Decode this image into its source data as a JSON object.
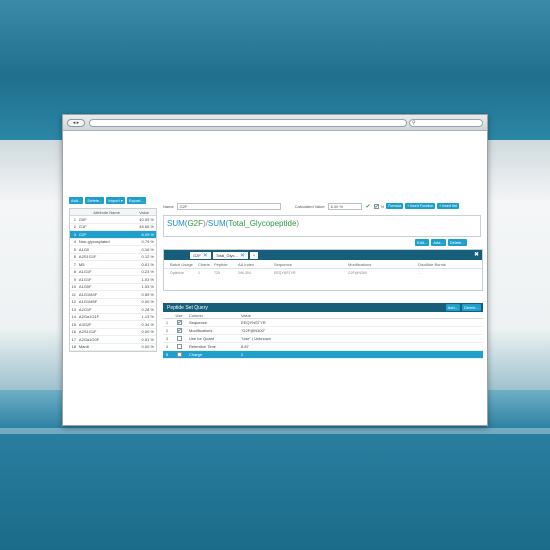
{
  "browser": {
    "nav_label": "◂ ▸",
    "search_icon_glyph": "⚲"
  },
  "left_panel": {
    "buttons": [
      "Add...",
      "Delete...",
      "Import ▾",
      "Export..."
    ],
    "headers": {
      "name": "Attribute Name",
      "value": "Value"
    },
    "rows": [
      {
        "num": "1",
        "name": "G0F",
        "value": "40.09 %"
      },
      {
        "num": "2",
        "name": "G1F",
        "value": "45.66 %"
      },
      {
        "num": "3",
        "name": "G2F",
        "value": "6.09 %"
      },
      {
        "num": "4",
        "name": "Non-glycosylated",
        "value": "0.79 %"
      },
      {
        "num": "5",
        "name": "A1G0",
        "value": "0.16 %"
      },
      {
        "num": "6",
        "name": "A2S1G1F",
        "value": "0.12 %"
      },
      {
        "num": "7",
        "name": "M5",
        "value": "0.61 %"
      },
      {
        "num": "8",
        "name": "A1G1F",
        "value": "0.23 %"
      },
      {
        "num": "9",
        "name": "A1G1F",
        "value": "1.03 %"
      },
      {
        "num": "10",
        "name": "A1G0F",
        "value": "1.53 %"
      },
      {
        "num": "11",
        "name": "A1G1M4F",
        "value": "0.59 %"
      },
      {
        "num": "12",
        "name": "A1G1M5F",
        "value": "0.00 %"
      },
      {
        "num": "13",
        "name": "A2G1F",
        "value": "0.28 %"
      },
      {
        "num": "14",
        "name": "A2Ga1G1F",
        "value": "1.13 %"
      },
      {
        "num": "15",
        "name": "A3G2F",
        "value": "0.34 %"
      },
      {
        "num": "16",
        "name": "A2S1G1F",
        "value": "0.00 %"
      },
      {
        "num": "17",
        "name": "A2Ga1G0F",
        "value": "0.51 %"
      },
      {
        "num": "18",
        "name": "Man6",
        "value": "0.00 %"
      }
    ],
    "selected_index": 2
  },
  "form": {
    "name_label": "Name",
    "name_value": "G2F",
    "calc_label": "Calculated Value",
    "calc_value": "6.00 %",
    "percent_label": "%",
    "btn_formula": "Formula",
    "btn_insert_function": "+ Insert Function",
    "btn_insert_set": "+ Insert Set"
  },
  "formula": {
    "p1": "SUM(",
    "p2": "G2F",
    "p3": ")/",
    "p4": "SUM(",
    "p5": "Total_Glycopeptide",
    "p6": ")"
  },
  "formula_buttons": [
    "Edit...",
    "Add...",
    "Delete..."
  ],
  "peptide_grid": {
    "tabs": [
      "G2F",
      "Total_Glyc..."
    ],
    "add_tab": "+",
    "headers": [
      "Batch Usage",
      "Charts",
      "Peptide",
      "AA Index",
      "Sequence",
      "Modifications",
      "Disulfide Bonds"
    ],
    "row": [
      "Optimize",
      "1",
      "T25",
      "296-304",
      "EEQYNSTYR",
      "G2F@N300",
      "..."
    ]
  },
  "psq": {
    "title": "Peptide Set Query",
    "buttons": [
      "Add...",
      "Delete..."
    ],
    "headers": {
      "use": "Use",
      "column": "Column",
      "value": "Value"
    },
    "rows": [
      {
        "num": "1",
        "use": true,
        "column": "Sequence",
        "value": "EEQYNSTYR"
      },
      {
        "num": "2",
        "use": true,
        "column": "Modifications",
        "value": "\"G2F@N300\""
      },
      {
        "num": "3",
        "use": false,
        "column": "Use for Quant",
        "value": "\"Use\" | Unknown"
      },
      {
        "num": "4",
        "use": false,
        "column": "Retention Time",
        "value": "8.87"
      },
      {
        "num": "5",
        "use": false,
        "column": "Charge",
        "value": "2"
      }
    ],
    "selected_index": 4
  },
  "colors": {
    "accent": "#1fa0cc",
    "header_dark": "#165e7a",
    "formula_blue": "#1a8fc7",
    "formula_green": "#2e9a3f"
  }
}
